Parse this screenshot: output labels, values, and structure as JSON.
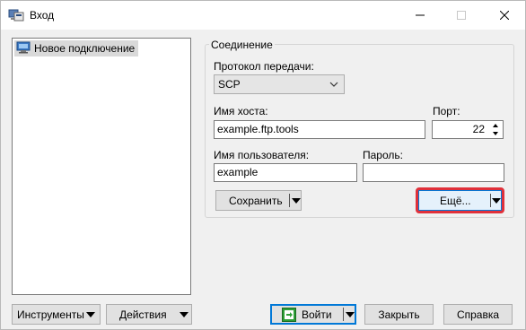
{
  "window": {
    "title": "Вход",
    "icons": {
      "app": "winscp-login-icon",
      "minimize": "minimize-icon",
      "maximize": "maximize-icon",
      "close": "close-icon"
    }
  },
  "sites": {
    "items": [
      {
        "label": "Новое подключение",
        "icon": "computer-icon",
        "selected": true
      }
    ]
  },
  "connection": {
    "group_title": "Соединение",
    "protocol_label": "Протокол передачи:",
    "protocol_value": "SCP",
    "host_label": "Имя хоста:",
    "host_value": "example.ftp.tools",
    "port_label": "Порт:",
    "port_value": "22",
    "user_label": "Имя пользователя:",
    "user_value": "example",
    "password_label": "Пароль:",
    "password_value": "",
    "save_label": "Сохранить",
    "more_label": "Ещё..."
  },
  "bottom": {
    "tools_label": "Инструменты",
    "actions_label": "Действия",
    "login_label": "Войти",
    "close_label": "Закрыть",
    "help_label": "Справка"
  },
  "colors": {
    "highlight": "#e0303a",
    "window_bg": "#f0f0f0",
    "login_icon": "#2e9e38"
  }
}
